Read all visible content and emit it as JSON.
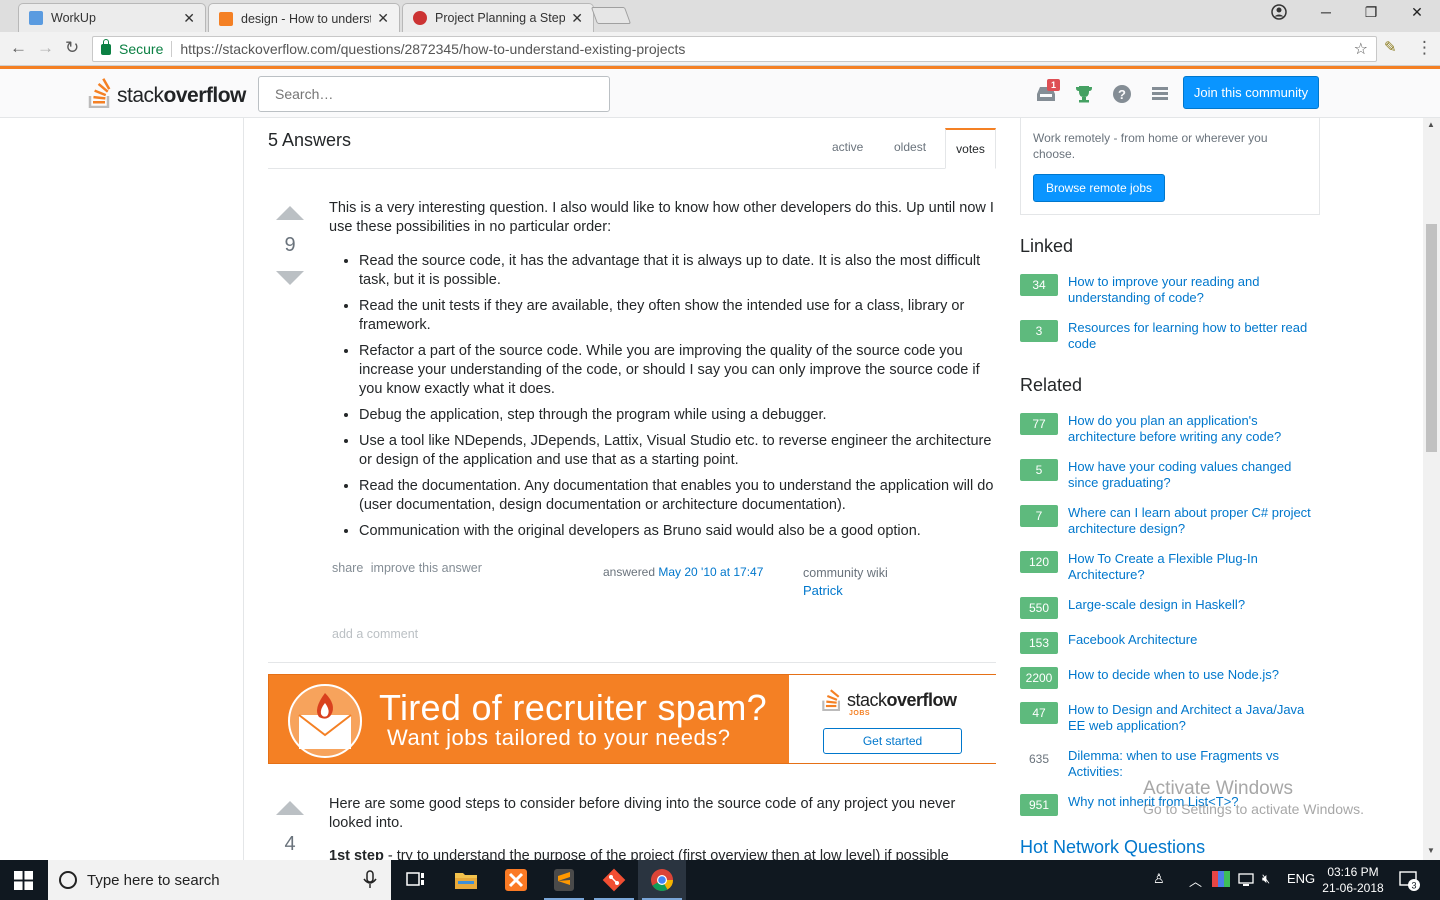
{
  "browser": {
    "tabs": [
      {
        "label": "WorkUp",
        "favicon_color": "#5a9be0"
      },
      {
        "label": "design - How to understa",
        "favicon_color": "#f48024"
      },
      {
        "label": "Project Planning a Step b",
        "favicon_color": "#cc3333"
      }
    ],
    "secure_label": "Secure",
    "url": "https://stackoverflow.com/questions/2872345/how-to-understand-existing-projects"
  },
  "header": {
    "logo_light": "stack",
    "logo_bold": "overflow",
    "search_placeholder": "Search…",
    "inbox_count": "1",
    "join_label": "Join this community"
  },
  "answers": {
    "title": "5 Answers",
    "sort_tabs": [
      "active",
      "oldest",
      "votes"
    ]
  },
  "answer1": {
    "votes": "9",
    "intro": "This is a very interesting question. I also would like to know how other developers do this. Up until now I use these possibilities in no particular order:",
    "items": [
      "Read the source code, it has the advantage that it is always up to date. It is also the most difficult task, but it is possible.",
      "Read the unit tests if they are available, they often show the intended use for a class, library or framework.",
      "Refactor a part of the source code. While you are improving the quality of the source code you increase your understanding of the code, or should I say you can only improve the source code if you know exactly what it does.",
      "Debug the application, step through the program while using a debugger.",
      "Use a tool like NDepends, JDepends, Lattix, Visual Studio etc. to reverse engineer the architecture or design of the application and use that as a starting point.",
      "Read the documentation. Any documentation that enables you to understand the application will do (user documentation, design documentation or architecture documentation).",
      "Communication with the original developers as Bruno said would also be a good option."
    ],
    "share_label": "share",
    "improve_label": "improve this answer",
    "answered_label": "answered",
    "answered_date": "May 20 '10 at 17:47",
    "wiki_label": "community wiki",
    "user": "Patrick",
    "add_comment": "add a comment"
  },
  "ad": {
    "headline": "Tired of recruiter spam?",
    "subline": "Want jobs tailored to your needs?",
    "logo_light": "stack",
    "logo_bold": "overflow",
    "logo_jobs": "JOBS",
    "cta": "Get started"
  },
  "answer2": {
    "votes": "4",
    "intro": "Here are some good steps to consider before diving into the source code of any project you never looked into.",
    "step_label": "1st step",
    "step_text": " - try to understand the purpose of the project (first overview then at low level) if possible"
  },
  "sidebar": {
    "remote_text": "Work remotely - from home or wherever you choose.",
    "remote_btn": "Browse remote jobs",
    "linked_title": "Linked",
    "linked": [
      {
        "score": "34",
        "title": "How to improve your reading and understanding of code?"
      },
      {
        "score": "3",
        "title": "Resources for learning how to better read code"
      }
    ],
    "related_title": "Related",
    "related": [
      {
        "score": "77",
        "title": "How do you plan an application's architecture before writing any code?"
      },
      {
        "score": "5",
        "title": "How have your coding values changed since graduating?"
      },
      {
        "score": "7",
        "title": "Where can I learn about proper C# project architecture design?"
      },
      {
        "score": "120",
        "title": "How To Create a Flexible Plug-In Architecture?"
      },
      {
        "score": "550",
        "title": "Large-scale design in Haskell?"
      },
      {
        "score": "153",
        "title": "Facebook Architecture"
      },
      {
        "score": "2200",
        "title": "How to decide when to use Node.js?"
      },
      {
        "score": "47",
        "title": "How to Design and Architect a Java/Java EE web application?"
      },
      {
        "score": "635",
        "title": "Dilemma: when to use Fragments vs Activities:"
      },
      {
        "score": "951",
        "title": "Why not inherit from List<T>?"
      }
    ],
    "hot_title": "Hot Network Questions"
  },
  "watermark": {
    "line1": "Activate Windows",
    "line2": "Go to Settings to activate Windows."
  },
  "taskbar": {
    "search_text": "Type here to search",
    "lang": "ENG",
    "time": "03:16 PM",
    "date": "21-06-2018",
    "notif_count": "3"
  }
}
